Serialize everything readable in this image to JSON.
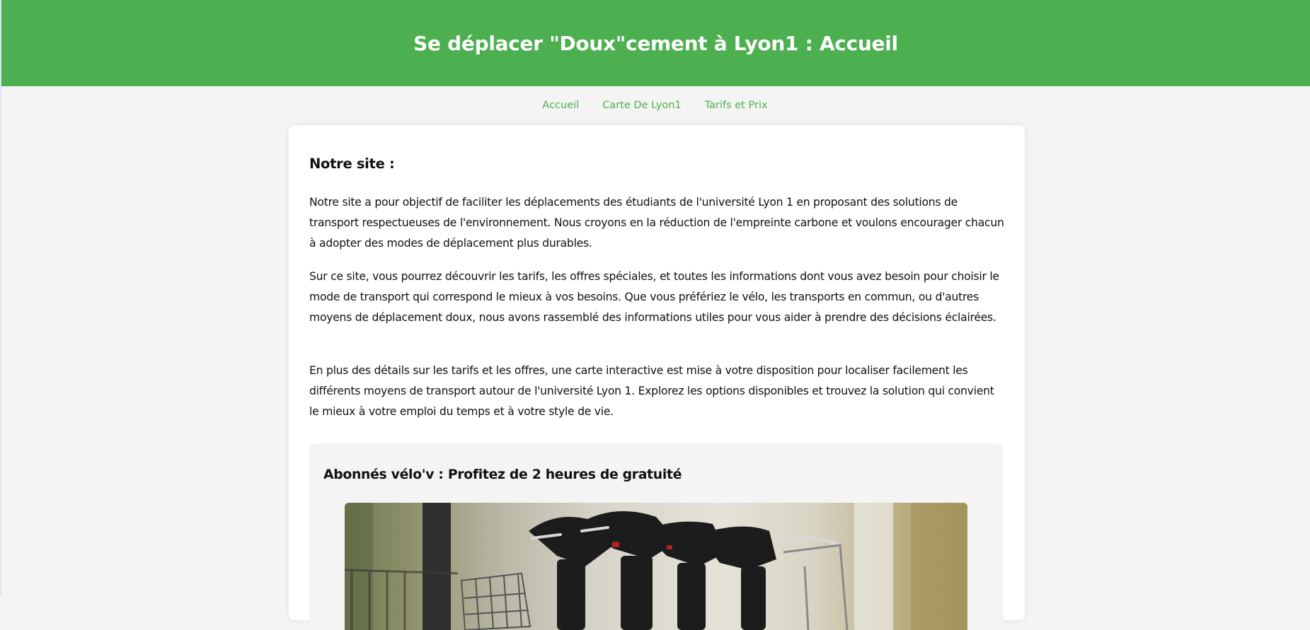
{
  "header": {
    "title": "Se déplacer \"Doux\"cement à Lyon1 : Accueil"
  },
  "nav": {
    "items": [
      {
        "label": "Accueil"
      },
      {
        "label": "Carte De Lyon1"
      },
      {
        "label": "Tarifs et Prix"
      }
    ]
  },
  "main": {
    "heading": "Notre site :",
    "paragraphs": [
      "Notre site a pour objectif de faciliter les déplacements des étudiants de l'université Lyon 1 en proposant des solutions de transport respectueuses de l'environnement. Nous croyons en la réduction de l'empreinte carbone et voulons encourager chacun à adopter des modes de déplacement plus durables.",
      "Sur ce site, vous pourrez découvrir les tarifs, les offres spéciales, et toutes les informations dont vous avez besoin pour choisir le mode de transport qui correspond le mieux à vos besoins. Que vous préfériez le vélo, les transports en commun, ou d'autres moyens de déplacement doux, nous avons rassemblé des informations utiles pour vous aider à prendre des décisions éclairées.",
      "En plus des détails sur les tarifs et les offres, une carte interactive est mise à votre disposition pour localiser facilement les différents moyens de transport autour de l'université Lyon 1. Explorez les options disponibles et trouvez la solution qui convient le mieux à votre emploi du temps et à votre style de vie."
    ],
    "promo": {
      "title": "Abonnés vélo'v : Profitez de 2 heures de gratuité"
    }
  },
  "colors": {
    "accent": "#4caf50",
    "background": "#f4f4f4"
  }
}
